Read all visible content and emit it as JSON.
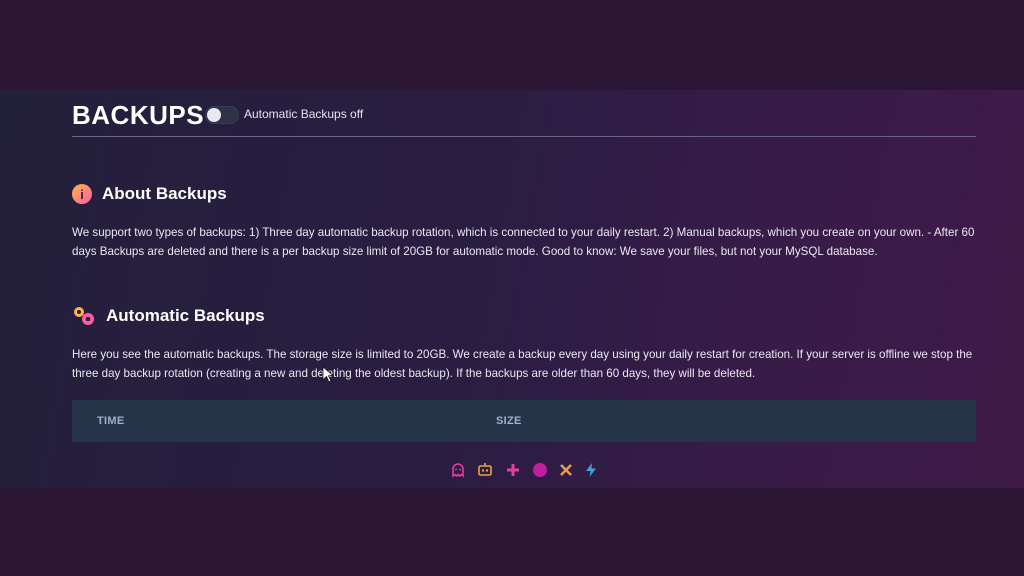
{
  "header": {
    "title": "BACKUPS",
    "toggle_label": "Automatic Backups off",
    "toggle_state": "off"
  },
  "about": {
    "title": "About Backups",
    "icon": "info-icon",
    "text": "We support two types of backups: 1) Three day automatic backup rotation, which is connected to your daily restart. 2) Manual backups, which you create on your own. - After 60 days Backups are deleted and there is a per backup size limit of 20GB for automatic mode. Good to know: We save your files, but not your MySQL database."
  },
  "automatic": {
    "title": "Automatic Backups",
    "icon": "gears-icon",
    "text": "Here you see the automatic backups. The storage size is limited to 20GB. We create a backup every day using your daily restart for creation. If your server is offline we stop the three day backup rotation (creating a new and deleting the oldest backup). If the backups are older than 60 days, they will be deleted."
  },
  "table": {
    "columns": [
      "TIME",
      "SIZE"
    ]
  },
  "footer_icons": [
    {
      "name": "ghost-icon",
      "color": "#e0409a"
    },
    {
      "name": "robot-icon",
      "color": "#f0a040"
    },
    {
      "name": "plus-icon",
      "color": "#e040a0"
    },
    {
      "name": "circle-icon",
      "color": "#c020a0"
    },
    {
      "name": "cross-icon",
      "color": "#e0a050"
    },
    {
      "name": "lightning-icon",
      "color": "#40a0d0"
    }
  ],
  "colors": {
    "accent_pink": "#ff5fa2",
    "accent_orange": "#ffb347",
    "table_header_bg": "#263449"
  }
}
